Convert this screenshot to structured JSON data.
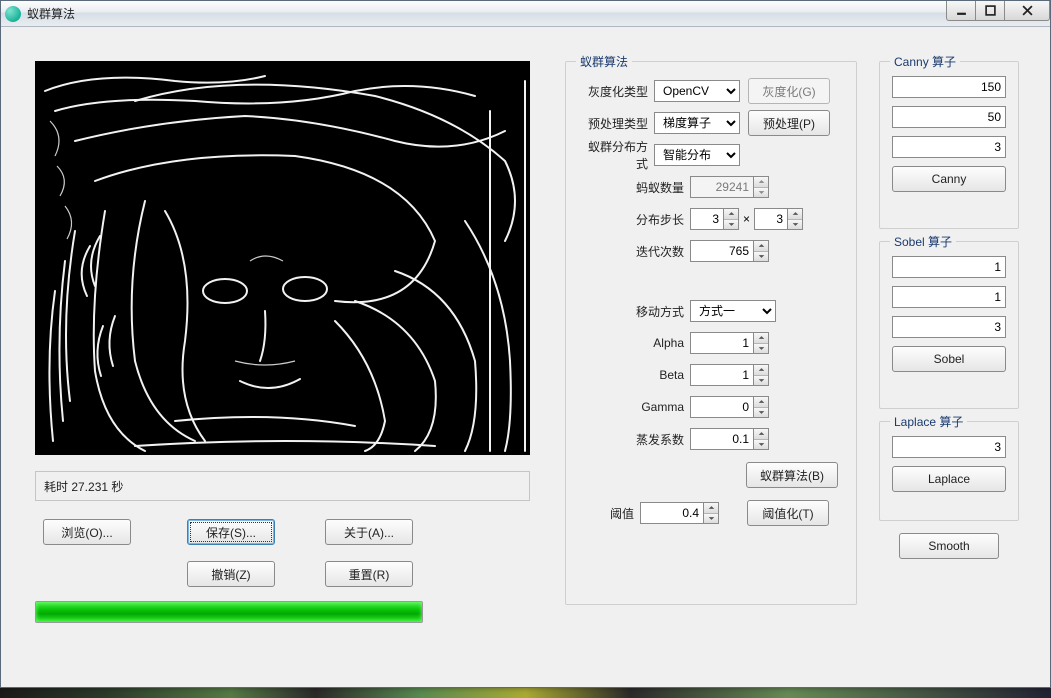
{
  "window": {
    "title": "蚁群算法"
  },
  "status": {
    "text": "耗时 27.231 秒"
  },
  "buttons": {
    "browse": "浏览(O)...",
    "save": "保存(S)...",
    "about": "关于(A)...",
    "undo": "撤销(Z)",
    "reset": "重置(R)"
  },
  "progress": {
    "percent": 100
  },
  "main": {
    "legend": "蚁群算法",
    "gray_label": "灰度化类型",
    "gray_select": "OpenCV",
    "gray_btn": "灰度化(G)",
    "pre_label": "预处理类型",
    "pre_select": "梯度算子",
    "pre_btn": "预处理(P)",
    "dist_label": "蚁群分布方式",
    "dist_select": "智能分布",
    "ant_count_label": "蚂蚁数量",
    "ant_count": "29241",
    "step_label": "分布步长",
    "step_x": "3",
    "step_y": "3",
    "iter_label": "迭代次数",
    "iter": "765",
    "move_label": "移动方式",
    "move_select": "方式一",
    "alpha_label": "Alpha",
    "alpha": "1",
    "beta_label": "Beta",
    "beta": "1",
    "gamma_label": "Gamma",
    "gamma": "0",
    "evap_label": "蒸发系数",
    "evap": "0.1",
    "run_btn": "蚁群算法(B)",
    "thresh_label": "阈值",
    "thresh": "0.4",
    "thresh_btn": "阈值化(T)"
  },
  "canny": {
    "legend": "Canny 算子",
    "v1": "150",
    "v2": "50",
    "v3": "3",
    "btn": "Canny"
  },
  "sobel": {
    "legend": "Sobel 算子",
    "v1": "1",
    "v2": "1",
    "v3": "3",
    "btn": "Sobel"
  },
  "laplace": {
    "legend": "Laplace 算子",
    "v1": "3",
    "btn": "Laplace"
  },
  "smooth": {
    "btn": "Smooth"
  }
}
